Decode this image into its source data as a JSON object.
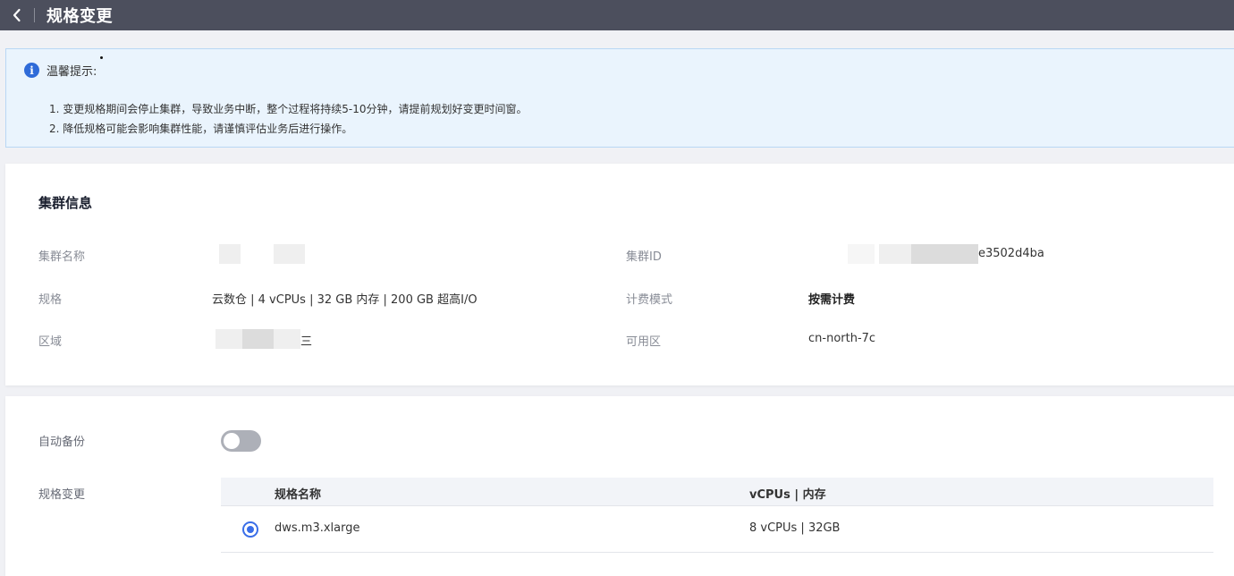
{
  "header": {
    "title": "规格变更"
  },
  "notice": {
    "title": "温馨提示:",
    "lines": [
      "1. 变更规格期间会停止集群，导致业务中断，整个过程将持续5-10分钟，请提前规划好变更时间窗。",
      "2. 降低规格可能会影响集群性能，请谨慎评估业务后进行操作。"
    ]
  },
  "cluster_info": {
    "section_title": "集群信息",
    "name_label": "集群名称",
    "id_label": "集群ID",
    "id_value": "e3502d4ba",
    "spec_label": "规格",
    "spec_value": "云数仓 | 4 vCPUs | 32 GB 内存 | 200 GB 超高I/O",
    "billing_label": "计费模式",
    "billing_value": "按需计费",
    "region_label": "区域",
    "region_value": "三",
    "az_label": "可用区",
    "az_value": "cn-north-7c"
  },
  "spec_change": {
    "auto_backup_label": "自动备份",
    "spec_change_label": "规格变更",
    "columns": [
      "规格名称",
      "vCPUs | 内存"
    ],
    "rows": [
      {
        "name": "dws.m3.xlarge",
        "resources": "8 vCPUs | 32GB"
      }
    ]
  }
}
